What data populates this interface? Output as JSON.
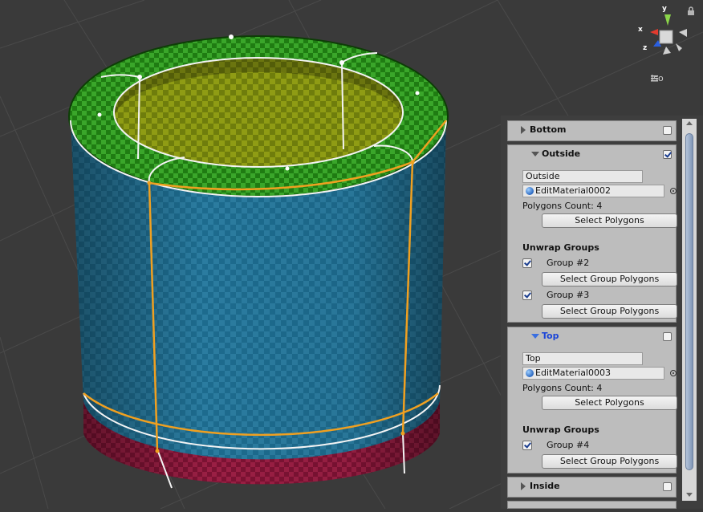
{
  "scene": {
    "gizmo": {
      "x_label": "x",
      "y_label": "y",
      "z_label": "z",
      "projection_label": "Iso"
    }
  },
  "inspector": {
    "sections": [
      {
        "title": "Bottom",
        "expanded": false,
        "enabled": false
      },
      {
        "title": "Outside",
        "expanded": true,
        "enabled": true,
        "name_value": "Outside",
        "material": "EditMaterial0002",
        "polygons_count": "Polygons Count: 4",
        "select_polygons_label": "Select Polygons",
        "unwrap_groups_label": "Unwrap Groups",
        "groups": [
          {
            "label": "Group #2",
            "checked": true,
            "button": "Select Group Polygons"
          },
          {
            "label": "Group #3",
            "checked": true,
            "button": "Select Group Polygons"
          }
        ]
      },
      {
        "title": "Top",
        "expanded": true,
        "enabled": false,
        "selected": true,
        "name_value": "Top",
        "material": "EditMaterial0003",
        "polygons_count": "Polygons Count: 4",
        "select_polygons_label": "Select Polygons",
        "unwrap_groups_label": "Unwrap Groups",
        "groups": [
          {
            "label": "Group #4",
            "checked": true,
            "button": "Select Group Polygons"
          }
        ]
      },
      {
        "title": "Inside",
        "expanded": false,
        "enabled": false
      }
    ]
  },
  "colors": {
    "outside_face": "#1d6a8c",
    "top_face": "#2a8f1c",
    "inside_face": "#8a9a12",
    "bottom_face": "#8b1a3a",
    "edge_highlight": "#f0a020",
    "selected_title": "#1b45d8"
  }
}
